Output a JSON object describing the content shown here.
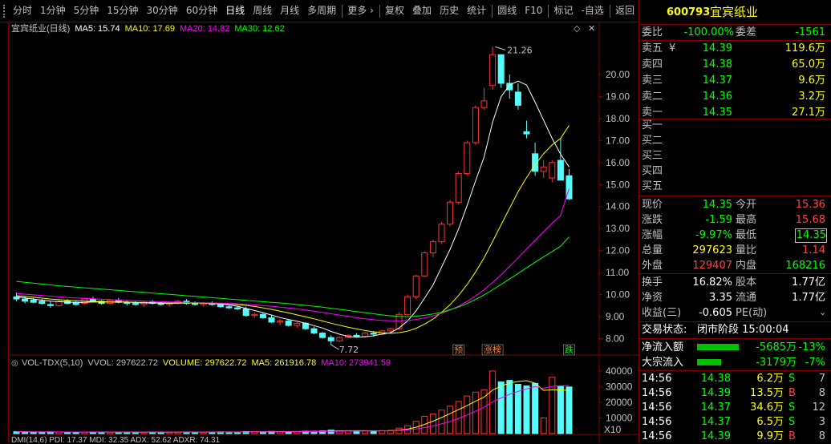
{
  "toolbar": {
    "items": [
      "分时",
      "1分钟",
      "5分钟",
      "15分钟",
      "30分钟",
      "60分钟",
      "日线",
      "周线",
      "月线",
      "多周期",
      "更多 ›",
      "复权",
      "叠加",
      "历史",
      "统计",
      "圆线",
      "F10",
      "标记",
      "-自选",
      "返回"
    ],
    "active": "日线"
  },
  "chart_header": {
    "title": "宜宾纸业(日线)",
    "ma5": "MA5: 15.74",
    "ma10": "MA10: 17.69",
    "ma20": "MA20: 14.82",
    "ma30": "MA30: 12.62"
  },
  "annotations": {
    "high": "21.26",
    "low": "7.72",
    "marker_yu": "预",
    "marker_zhangbang": "涨榜",
    "marker_die": "跌"
  },
  "vol_header": {
    "title": "VOL-TDX(5,10)",
    "vvol": "VVOL: 297622.72",
    "volume": "VOLUME: 297622.72",
    "ma5": "MA5: 261916.78",
    "ma10": "MA10: 273941.59"
  },
  "bottom_header": {
    "text": "DMI(14,6) PDI: 17.37 MDI: 32.35 ADX: 52.62 ADXR: 74.31"
  },
  "vol_unit": "X10",
  "colors": {
    "up": "#ff3232",
    "down": "#54fcfc",
    "ma5": "#ffffff",
    "ma10": "#ffff00",
    "ma20": "#ff00ff",
    "ma30": "#00ff00",
    "frame": "#800000"
  },
  "chart_data": {
    "type": "candlestick",
    "price_axis_ticks": [
      "20.00",
      "19.00",
      "18.00",
      "17.00",
      "16.00",
      "15.00",
      "14.00",
      "13.00",
      "12.00",
      "11.00",
      "10.00",
      "9.00",
      "8.00"
    ],
    "price_range": [
      7.4,
      21.6
    ],
    "volume_axis_ticks": [
      "40000",
      "30000",
      "20000",
      "10000"
    ],
    "volume_range": [
      0,
      42000
    ],
    "candles": [
      [
        9.9,
        10.1,
        9.7,
        9.8
      ],
      [
        9.8,
        9.9,
        9.6,
        9.7
      ],
      [
        9.75,
        9.85,
        9.6,
        9.65
      ],
      [
        9.7,
        9.8,
        9.55,
        9.6
      ],
      [
        9.55,
        9.7,
        9.4,
        9.5
      ],
      [
        9.5,
        9.75,
        9.45,
        9.7
      ],
      [
        9.7,
        9.8,
        9.55,
        9.6
      ],
      [
        9.65,
        9.75,
        9.5,
        9.55
      ],
      [
        9.6,
        9.85,
        9.55,
        9.8
      ],
      [
        9.8,
        9.9,
        9.65,
        9.7
      ],
      [
        9.7,
        9.75,
        9.55,
        9.6
      ],
      [
        9.6,
        9.8,
        9.55,
        9.75
      ],
      [
        9.75,
        9.85,
        9.6,
        9.65
      ],
      [
        9.65,
        9.75,
        9.5,
        9.6
      ],
      [
        9.6,
        9.7,
        9.5,
        9.55
      ],
      [
        9.55,
        9.7,
        9.45,
        9.65
      ],
      [
        9.65,
        9.75,
        9.55,
        9.6
      ],
      [
        9.6,
        9.7,
        9.5,
        9.55
      ],
      [
        9.55,
        9.65,
        9.45,
        9.6
      ],
      [
        9.6,
        9.75,
        9.55,
        9.7
      ],
      [
        9.7,
        9.8,
        9.55,
        9.6
      ],
      [
        9.6,
        9.7,
        9.5,
        9.55
      ],
      [
        9.55,
        9.65,
        9.45,
        9.6
      ],
      [
        9.6,
        9.7,
        9.5,
        9.55
      ],
      [
        9.55,
        9.6,
        9.4,
        9.45
      ],
      [
        9.45,
        9.55,
        9.35,
        9.4
      ],
      [
        9.4,
        9.5,
        9.3,
        9.35
      ],
      [
        9.35,
        9.45,
        9.0,
        9.05
      ],
      [
        9.05,
        9.2,
        8.95,
        9.1
      ],
      [
        9.1,
        9.2,
        8.9,
        8.95
      ],
      [
        8.95,
        9.05,
        8.7,
        8.75
      ],
      [
        8.75,
        8.9,
        8.6,
        8.8
      ],
      [
        8.8,
        8.85,
        8.55,
        8.6
      ],
      [
        8.6,
        8.75,
        8.5,
        8.7
      ],
      [
        8.7,
        8.75,
        8.4,
        8.45
      ],
      [
        8.45,
        8.55,
        8.2,
        8.25
      ],
      [
        8.25,
        8.3,
        8.0,
        8.05
      ],
      [
        8.05,
        8.15,
        7.72,
        7.9
      ],
      [
        7.9,
        8.1,
        7.85,
        8.05
      ],
      [
        8.05,
        8.2,
        8.0,
        8.15
      ],
      [
        8.15,
        8.25,
        8.05,
        8.1
      ],
      [
        8.1,
        8.3,
        8.05,
        8.25
      ],
      [
        8.25,
        8.35,
        8.1,
        8.2
      ],
      [
        8.2,
        8.4,
        8.15,
        8.35
      ],
      [
        8.35,
        8.5,
        8.3,
        8.45
      ],
      [
        8.45,
        9.2,
        8.4,
        9.1
      ],
      [
        9.1,
        10.0,
        9.05,
        9.9
      ],
      [
        9.9,
        10.9,
        9.8,
        10.85
      ],
      [
        10.85,
        11.95,
        10.8,
        11.9
      ],
      [
        11.9,
        12.5,
        11.7,
        12.4
      ],
      [
        12.4,
        13.3,
        12.3,
        13.2
      ],
      [
        13.2,
        14.3,
        13.1,
        14.2
      ],
      [
        14.2,
        15.6,
        14.1,
        15.5
      ],
      [
        15.5,
        17.0,
        15.4,
        16.9
      ],
      [
        16.9,
        18.6,
        16.8,
        18.5
      ],
      [
        18.5,
        19.4,
        18.4,
        18.8
      ],
      [
        19.5,
        21.26,
        19.3,
        20.9
      ],
      [
        20.9,
        20.9,
        19.4,
        19.6
      ],
      [
        19.6,
        20.0,
        18.9,
        19.3
      ],
      [
        19.2,
        19.6,
        18.4,
        18.6
      ],
      [
        17.4,
        17.9,
        17.1,
        17.3
      ],
      [
        16.4,
        16.9,
        15.4,
        15.6
      ],
      [
        15.6,
        16.1,
        15.3,
        15.8
      ],
      [
        15.3,
        16.1,
        15.1,
        16.0
      ],
      [
        16.1,
        17.1,
        15.2,
        15.2
      ],
      [
        15.4,
        15.7,
        14.3,
        14.35
      ]
    ],
    "volumes": [
      1200,
      1100,
      1000,
      900,
      1100,
      1000,
      950,
      900,
      1000,
      1050,
      900,
      950,
      1000,
      900,
      950,
      900,
      1000,
      950,
      900,
      1000,
      1050,
      950,
      900,
      1000,
      1100,
      1050,
      1000,
      1300,
      1200,
      1150,
      1400,
      1300,
      1250,
      1350,
      1500,
      1400,
      1700,
      2200,
      1800,
      1900,
      1600,
      1700,
      1800,
      1900,
      2100,
      3500,
      5000,
      7800,
      11000,
      12500,
      15000,
      17500,
      20500,
      24000,
      26500,
      28000,
      40000,
      33000,
      34000,
      31500,
      30500,
      32000,
      10000,
      36000,
      30500,
      29800
    ],
    "ma5": [
      9.9,
      9.85,
      9.8,
      9.75,
      9.7,
      9.68,
      9.66,
      9.64,
      9.65,
      9.66,
      9.66,
      9.66,
      9.67,
      9.66,
      9.64,
      9.62,
      9.62,
      9.61,
      9.6,
      9.61,
      9.62,
      9.62,
      9.61,
      9.6,
      9.57,
      9.53,
      9.47,
      9.37,
      9.28,
      9.18,
      9.07,
      8.96,
      8.87,
      8.79,
      8.7,
      8.59,
      8.48,
      8.33,
      8.2,
      8.1,
      8.06,
      8.08,
      8.13,
      8.21,
      8.27,
      8.48,
      8.8,
      9.26,
      9.84,
      10.44,
      11.25,
      12.06,
      12.98,
      14.04,
      15.17,
      16.25,
      17.83,
      18.99,
      19.52,
      19.7,
      19.52,
      18.74,
      17.92,
      17.1,
      16.38,
      15.8
    ],
    "ma10": [
      9.95,
      9.92,
      9.88,
      9.84,
      9.8,
      9.77,
      9.74,
      9.72,
      9.7,
      9.69,
      9.68,
      9.67,
      9.66,
      9.66,
      9.65,
      9.64,
      9.63,
      9.63,
      9.62,
      9.62,
      9.62,
      9.62,
      9.62,
      9.61,
      9.6,
      9.58,
      9.55,
      9.51,
      9.46,
      9.4,
      9.33,
      9.25,
      9.17,
      9.08,
      8.99,
      8.9,
      8.8,
      8.7,
      8.61,
      8.52,
      8.44,
      8.37,
      8.31,
      8.27,
      8.24,
      8.27,
      8.34,
      8.47,
      8.66,
      8.89,
      9.2,
      9.54,
      9.96,
      10.46,
      11.03,
      11.67,
      12.41,
      13.17,
      13.92,
      14.67,
      15.32,
      15.9,
      16.4,
      16.8,
      17.1,
      17.69
    ],
    "ma20": [
      10.05,
      10.02,
      9.99,
      9.96,
      9.93,
      9.9,
      9.87,
      9.85,
      9.83,
      9.81,
      9.79,
      9.77,
      9.75,
      9.73,
      9.72,
      9.7,
      9.69,
      9.68,
      9.67,
      9.66,
      9.65,
      9.64,
      9.63,
      9.62,
      9.61,
      9.6,
      9.58,
      9.56,
      9.53,
      9.5,
      9.47,
      9.43,
      9.39,
      9.35,
      9.3,
      9.25,
      9.19,
      9.13,
      9.07,
      9.01,
      8.95,
      8.9,
      8.86,
      8.83,
      8.81,
      8.81,
      8.83,
      8.87,
      8.94,
      9.03,
      9.15,
      9.3,
      9.48,
      9.69,
      9.94,
      10.22,
      10.55,
      10.9,
      11.28,
      11.67,
      12.07,
      12.47,
      12.86,
      13.24,
      13.6,
      14.82
    ],
    "ma30": [
      10.6,
      10.56,
      10.52,
      10.48,
      10.44,
      10.4,
      10.37,
      10.34,
      10.31,
      10.28,
      10.25,
      10.22,
      10.19,
      10.16,
      10.13,
      10.1,
      10.07,
      10.04,
      10.01,
      9.98,
      9.95,
      9.92,
      9.89,
      9.86,
      9.83,
      9.8,
      9.77,
      9.74,
      9.71,
      9.68,
      9.65,
      9.62,
      9.59,
      9.55,
      9.51,
      9.47,
      9.43,
      9.38,
      9.33,
      9.28,
      9.23,
      9.18,
      9.13,
      9.08,
      9.04,
      9.01,
      9.0,
      9.02,
      9.06,
      9.12,
      9.2,
      9.31,
      9.44,
      9.6,
      9.78,
      9.99,
      10.22,
      10.46,
      10.71,
      10.96,
      11.22,
      11.47,
      11.72,
      11.96,
      12.2,
      12.62
    ]
  },
  "panel": {
    "code": "600793",
    "name": "宜宾纸业",
    "weibi_label": "委比",
    "weibi_value": "-100.00%",
    "weicha_label": "委差",
    "weicha_value": "-1561",
    "asks": [
      {
        "label": "卖五",
        "flag": "¥",
        "price": "14.39",
        "vol": "119.6万"
      },
      {
        "label": "卖四",
        "flag": "",
        "price": "14.38",
        "vol": "65.0万"
      },
      {
        "label": "卖三",
        "flag": "",
        "price": "14.37",
        "vol": "9.6万"
      },
      {
        "label": "卖二",
        "flag": "",
        "price": "14.36",
        "vol": "3.2万"
      },
      {
        "label": "卖一",
        "flag": "",
        "price": "14.35",
        "vol": "27.1万"
      }
    ],
    "bids": [
      "买一",
      "买二",
      "买三",
      "买四",
      "买五"
    ],
    "stats": [
      {
        "l1": "现价",
        "v1": "14.35",
        "c1": "c-green",
        "l2": "今开",
        "v2": "15.36",
        "c2": "c-red"
      },
      {
        "l1": "涨跌",
        "v1": "-1.59",
        "c1": "c-green",
        "l2": "最高",
        "v2": "15.68",
        "c2": "c-red"
      },
      {
        "l1": "涨幅",
        "v1": "-9.97%",
        "c1": "c-green",
        "l2": "最低",
        "v2": "14.35",
        "c2": "c-green"
      },
      {
        "l1": "总量",
        "v1": "297623",
        "c1": "c-yellow",
        "l2": "量比",
        "v2": "1.14",
        "c2": "c-red"
      },
      {
        "l1": "外盘",
        "v1": "129407",
        "c1": "c-red",
        "l2": "内盘",
        "v2": "168216",
        "c2": "c-green"
      }
    ],
    "stats2": [
      {
        "l1": "换手",
        "v1": "16.82%",
        "l2": "股本",
        "v2": "1.77亿"
      },
      {
        "l1": "净资",
        "v1": "3.35",
        "l2": "流通",
        "v2": "1.77亿"
      },
      {
        "l1": "收益(三)",
        "v1": "-0.605",
        "l2": "PE(动)",
        "v2": ""
      }
    ],
    "trade_status_label": "交易状态:",
    "trade_status_value": "闭市阶段 15:00:04",
    "flows": [
      {
        "label": "净流入额",
        "value": "-5685万",
        "pct": "-13%"
      },
      {
        "label": "大宗流入",
        "value": "-3179万",
        "pct": "-7%"
      }
    ],
    "ticks": [
      {
        "time": "14:56",
        "price": "14.38",
        "vol": "6.2万",
        "side": "S",
        "n": "7"
      },
      {
        "time": "14:56",
        "price": "14.39",
        "vol": "13.5万",
        "side": "B",
        "n": "8"
      },
      {
        "time": "14:56",
        "price": "14.37",
        "vol": "34.6万",
        "side": "S",
        "n": "12"
      },
      {
        "time": "14:56",
        "price": "14.37",
        "vol": "6.5万",
        "side": "S",
        "n": "3"
      },
      {
        "time": "14:56",
        "price": "14.39",
        "vol": "9.9万",
        "side": "B",
        "n": "8"
      }
    ]
  }
}
